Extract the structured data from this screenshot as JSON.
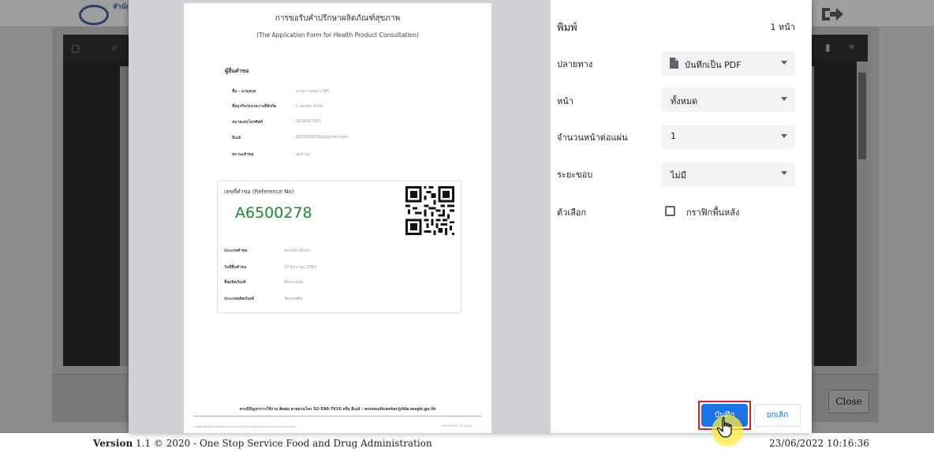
{
  "site": {
    "logo_text": "สำนักงาน กระทรวง",
    "footer_version_bold": "Version",
    "footer_version_rest": " 1.1 © 2020 - One Stop Service Food and Drug Administration",
    "footer_datetime": "23/06/2022 10:16:36"
  },
  "viewer": {
    "close_label": "Close"
  },
  "document": {
    "title": "การขอรับคำปรึกษาผลิตภัณฑ์สุขภาพ",
    "subtitle": "(The Application Form for Health Product Consultation)",
    "applicant_heading": "ผู้ยื่นคำขอ",
    "applicant_fields": [
      {
        "label": "ชื่อ - นามสกุล",
        "value": "นางสาวพรธรา วิศิริ"
      },
      {
        "label": "ชื่อธุรกิจ/หน่วยงานที่สังกัด",
        "value": "5 ทดสอบ จำกัด"
      },
      {
        "label": "หมายเลขโทรศัพท์",
        "value": "0639587925"
      },
      {
        "label": "อีเมล์",
        "value": "0625266816p@gmail.com"
      },
      {
        "label": "สถานะคำขอ",
        "value": "ส่งคำขอ"
      }
    ],
    "reference_label": "เลขที่คำขอ (Reference No)",
    "reference_number": "A6500278",
    "request_fields": [
      {
        "label": "ประเภทคำขอ",
        "value": "ขอรับคำปรึกษา"
      },
      {
        "label": "วันที่ยื่นคำขอ",
        "value": "23 มิถุนายน 2565"
      },
      {
        "label": "ชื่อผลิตภัณฑ์",
        "value": "ทีทกระท่อม"
      },
      {
        "label": "ประเภทผลิตภัณฑ์",
        "value": "วัตถุเสพติด"
      }
    ],
    "footer_contact": "หากมีปัญหาการใช้งาน ติดต่อ สายด่วนโทร 02-590-7616 หรือ อีเมล์ : econsultcenter@fda.moph.go.th",
    "footnote": "กองผลิตภัณฑ์สุขภาพนวัตกรรมและการบริการ สำนักงานคณะกรรมการอาหารและยา",
    "footnote_date": "23/06/2022 10:24:31"
  },
  "print": {
    "title": "พิมพ์",
    "page_count": "1 หน้า",
    "destination_label": "ปลายทาง",
    "destination_value": "บันทึกเป็น PDF",
    "pages_label": "หน้า",
    "pages_value": "ทั้งหมด",
    "per_sheet_label": "จำนวนหน้าต่อแผ่น",
    "per_sheet_value": "1",
    "margins_label": "ระยะขอบ",
    "margins_value": "ไม่มี",
    "options_label": "ตัวเลือก",
    "background_graphics_label": "กราฟิกพื้นหลัง",
    "save_label": "บันทึก",
    "cancel_label": "ยกเลิก"
  }
}
